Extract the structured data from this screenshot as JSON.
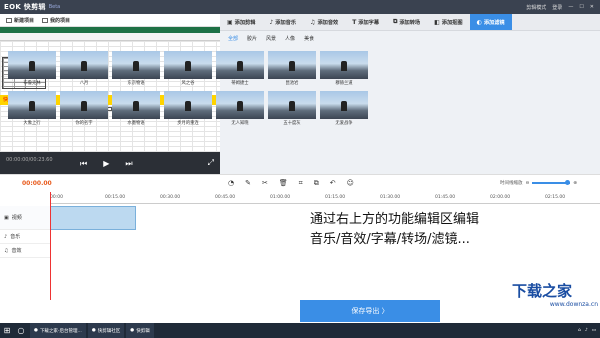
{
  "app": {
    "logo": "EOK 快剪辑",
    "version": "Beta"
  },
  "titlebar_right": {
    "mode": "剪辑模式",
    "login": "登录"
  },
  "toolbar": {
    "new_project": "新建项目",
    "my_projects": "我的项目"
  },
  "preview": {
    "sheet_yellow_text": "快速删除空行",
    "time": "00:00:00/00:23.60"
  },
  "tabs": [
    {
      "label": "添加剪辑",
      "icon": "film-icon"
    },
    {
      "label": "添加音乐",
      "icon": "music-icon"
    },
    {
      "label": "添加音效",
      "icon": "sound-icon"
    },
    {
      "label": "添加字幕",
      "icon": "text-icon"
    },
    {
      "label": "添加转场",
      "icon": "transition-icon"
    },
    {
      "label": "添加抠图",
      "icon": "cutout-icon"
    },
    {
      "label": "添加滤镜",
      "icon": "filter-icon",
      "active": true
    }
  ],
  "subtabs": [
    "全部",
    "胶片",
    "风景",
    "人像",
    "美食"
  ],
  "filters": [
    "布鲁克林",
    "八月",
    "东京物语",
    "风之谷",
    "蒂姆捷士",
    "昆池岩",
    "穆赫兰道",
    "大象上行",
    "你的名字",
    "水墨物语",
    "步月的重连",
    "无人知晓",
    "五十度灰",
    "无爱战争"
  ],
  "timeline": {
    "current_time": "00:00.00",
    "ticks": [
      "00:00",
      "00:15.00",
      "00:30.00",
      "00:45.00",
      "01:00.00",
      "01:15.00",
      "01:30.00",
      "01:45.00",
      "02:00.00",
      "02:15.00"
    ],
    "zoom_label": "时间线缩放",
    "tracks": [
      "视频",
      "音乐",
      "音效"
    ]
  },
  "overlay": {
    "line1": "通过右上方的功能编辑区编辑",
    "line2": "音乐/音效/字幕/转场/滤镜..."
  },
  "export_button": "保存导出 〉",
  "watermark": {
    "big": "下载之家",
    "small": "www.downza.cn"
  },
  "taskbar": {
    "apps": [
      "下载之家-后台管理...",
      "快剪辑社区",
      "快剪辑"
    ]
  },
  "colors": {
    "accent": "#3a8ee6",
    "titlebar": "#3a4250"
  }
}
